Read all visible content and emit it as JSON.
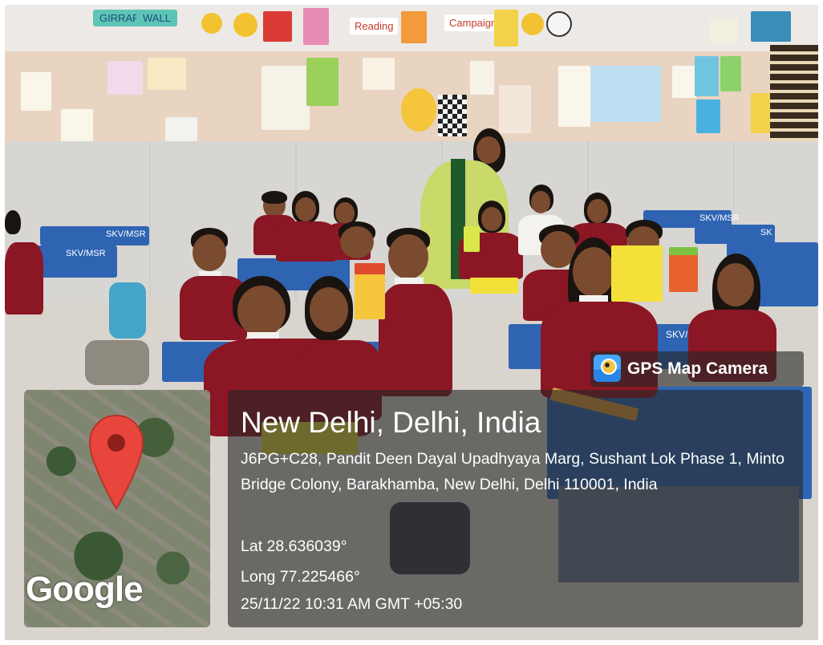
{
  "photo": {
    "scene": "",
    "wall_labels": [
      "GIRRAFE",
      "WALL",
      "Reading",
      "Campaign"
    ],
    "desk_labels": [
      "SKV/MSR",
      "SKV/MSR",
      "SKV/MSR",
      "SK",
      "SKV/"
    ]
  },
  "map_thumbnail": {
    "logo_text": "Google",
    "pin_color": "#e8463c"
  },
  "badge": {
    "label": "GPS Map Camera"
  },
  "location": {
    "title": "New Delhi, Delhi, India",
    "address": "J6PG+C28, Pandit Deen Dayal Upadhyaya Marg, Sushant Lok Phase 1, Minto Bridge Colony, Barakhamba, New Delhi, Delhi 110001, India",
    "lat": "Lat 28.636039°",
    "long": "Long 77.225466°",
    "timestamp": "25/11/22 10:31 AM GMT +05:30"
  }
}
